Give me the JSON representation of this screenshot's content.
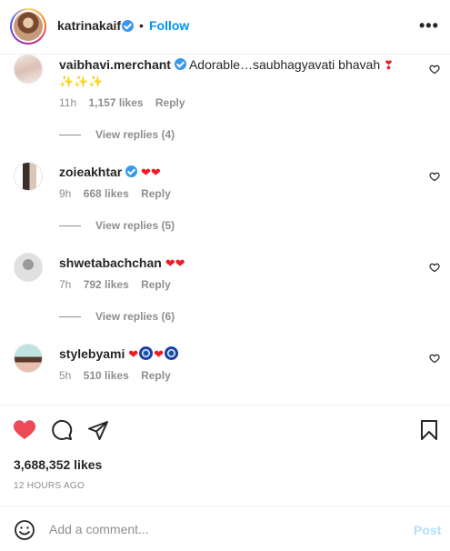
{
  "header": {
    "username": "katrinakaif",
    "separator": "•",
    "follow_label": "Follow",
    "more_label": "•••"
  },
  "comments": [
    {
      "username": "vaibhavi.merchant",
      "verified": true,
      "text": "Adorable…saubhagyavati bhavah",
      "emoji": [
        "heart-exclamation",
        "sparkles",
        "sparkles",
        "sparkles"
      ],
      "time": "11h",
      "likes": "1,157 likes",
      "reply_label": "Reply",
      "view_replies": "View replies (4)"
    },
    {
      "username": "zoieakhtar",
      "verified": true,
      "text": "",
      "emoji": [
        "red-heart",
        "red-heart"
      ],
      "time": "9h",
      "likes": "668 likes",
      "reply_label": "Reply",
      "view_replies": "View replies (5)"
    },
    {
      "username": "shwetabachchan",
      "verified": false,
      "text": "",
      "emoji": [
        "red-heart",
        "red-heart"
      ],
      "time": "7h",
      "likes": "792 likes",
      "reply_label": "Reply",
      "view_replies": "View replies (6)"
    },
    {
      "username": "stylebyami",
      "verified": false,
      "text": "",
      "emoji": [
        "red-heart",
        "nazar-amulet",
        "red-heart",
        "nazar-amulet"
      ],
      "time": "5h",
      "likes": "510 likes",
      "reply_label": "Reply",
      "view_replies": ""
    }
  ],
  "post": {
    "likes": "3,688,352 likes",
    "time_ago": "12 HOURS AGO",
    "liked": true
  },
  "add_comment": {
    "placeholder": "Add a comment...",
    "post_label": "Post"
  },
  "icons": [
    "like-heart-icon",
    "comment-icon",
    "share-icon",
    "save-icon",
    "emoji-icon",
    "more-icon",
    "verified-icon",
    "comment-like-icon"
  ],
  "colors": {
    "accent": "#0095f6",
    "like_red": "#ed4956",
    "post_disabled": "#b2dffc",
    "muted": "#8e8e8e",
    "verified": "#3897f0"
  }
}
